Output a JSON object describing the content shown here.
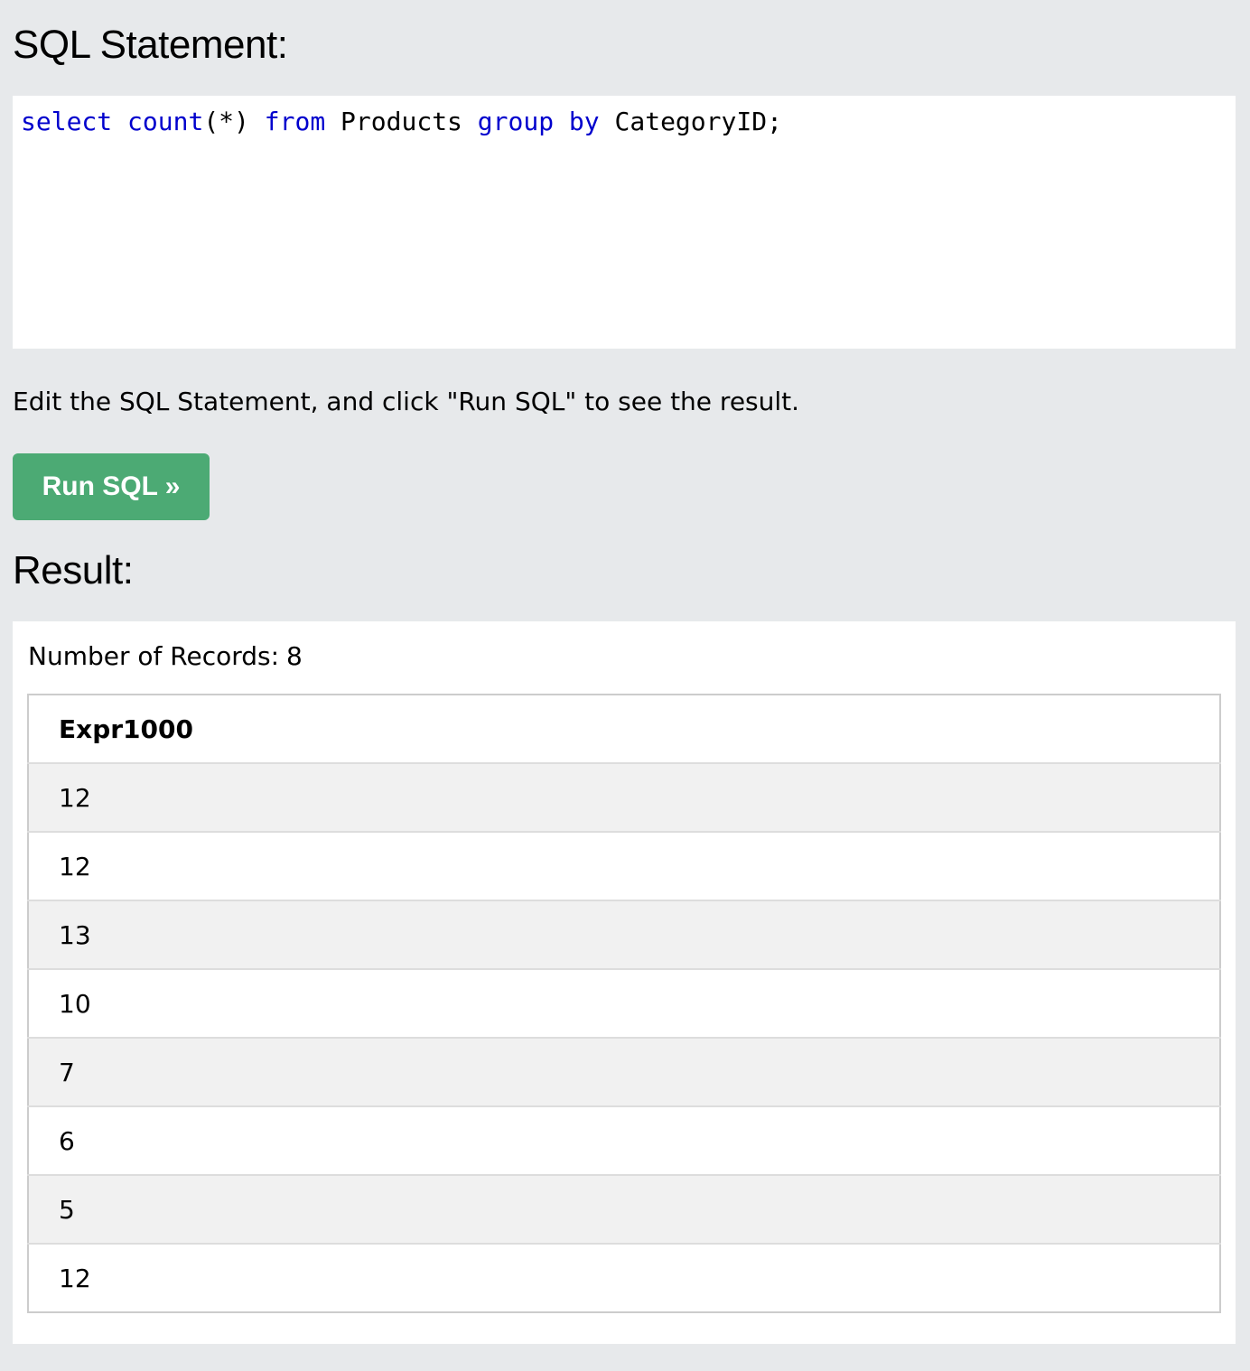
{
  "headings": {
    "sql_statement": "SQL Statement:",
    "result": "Result:"
  },
  "editor": {
    "tokens": {
      "select": "select",
      "count": "count",
      "star": "(*)",
      "from": "from",
      "table": "Products",
      "group": "group",
      "by": "by",
      "column": "CategoryID;"
    }
  },
  "instructions": "Edit the SQL Statement, and click \"Run SQL\" to see the result.",
  "run_button": {
    "label": "Run SQL »",
    "color": "#4caa74"
  },
  "result": {
    "records_label": "Number of Records:",
    "records_count": "8",
    "columns": [
      "Expr1000"
    ],
    "rows": [
      "12",
      "12",
      "13",
      "10",
      "7",
      "6",
      "5",
      "12"
    ]
  },
  "colors": {
    "page_background": "#e7e9eb",
    "keyword": "#0000cd",
    "row_stripe": "#f1f1f1"
  }
}
